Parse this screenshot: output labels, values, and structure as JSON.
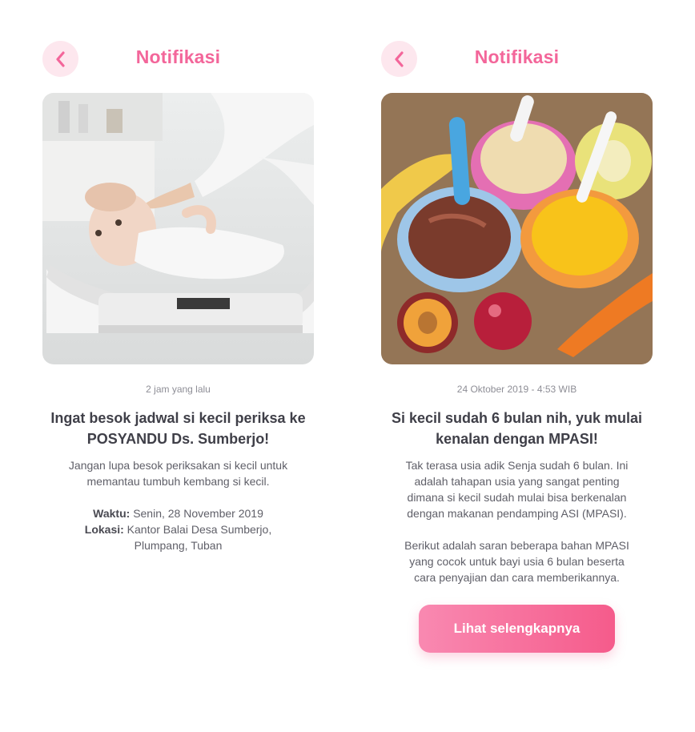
{
  "left": {
    "header_title": "Notifikasi",
    "image_alt": "baby-on-scale-photo",
    "timestamp": "2 jam yang lalu",
    "title": "Ingat besok jadwal si kecil periksa ke POSYANDU Ds. Sumberjo!",
    "body": "Jangan lupa besok periksakan si kecil untuk memantau tumbuh kembang si kecil.",
    "details": [
      {
        "label": "Waktu:",
        "value": "Senin, 28 November 2019"
      },
      {
        "label": "Lokasi:",
        "value": "Kantor Balai Desa Sumberjo, Plumpang, Tuban"
      }
    ]
  },
  "right": {
    "header_title": "Notifikasi",
    "image_alt": "baby-food-bowls-photo",
    "timestamp": "24 Oktober 2019 - 4:53 WIB",
    "title": "Si kecil sudah 6 bulan nih, yuk mulai kenalan dengan MPASI!",
    "paragraph1": "Tak terasa usia adik Senja sudah 6 bulan. Ini adalah tahapan usia yang sangat penting dimana si kecil sudah mulai bisa berkenalan dengan makanan pendamping ASI (MPASI).",
    "paragraph2": "Berikut adalah saran beberapa bahan MPASI yang cocok untuk bayi usia 6 bulan beserta cara penyajian dan cara memberikannya.",
    "cta_label": "Lihat selengkapnya"
  },
  "colors": {
    "accent": "#f3669a",
    "back_bg": "#fde7ee",
    "cta_start": "#f989b1",
    "cta_end": "#f55b8b"
  }
}
